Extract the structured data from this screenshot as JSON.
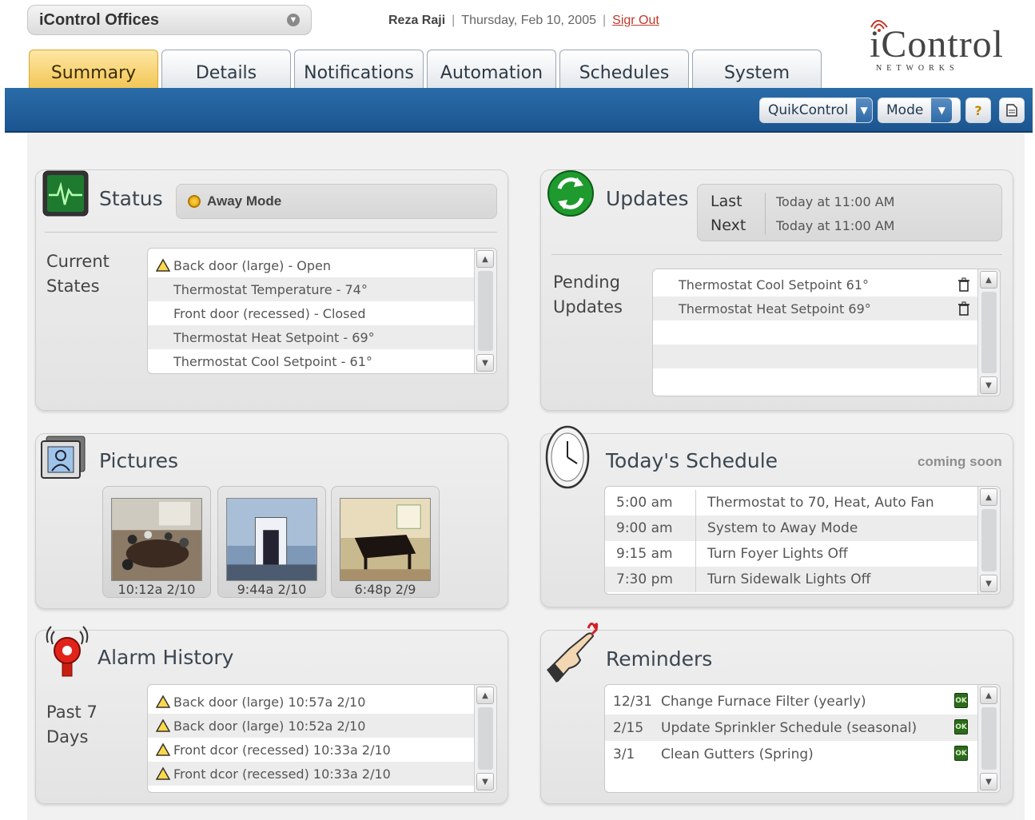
{
  "header": {
    "site_selector": "iControl Offices",
    "user": "Reza Raji",
    "separator": "|",
    "date": "Thursday, Feb 10, 2005",
    "sign_out": "Sigr Out",
    "logo_text": "iControl",
    "logo_sub": "NETWORKS"
  },
  "tabs": [
    {
      "label": "Summary",
      "active": true
    },
    {
      "label": "Details"
    },
    {
      "label": "Notifications"
    },
    {
      "label": "Automation"
    },
    {
      "label": "Schedules"
    },
    {
      "label": "System"
    }
  ],
  "toolbar": {
    "quikcontrol": "QuikControl",
    "mode": "Mode",
    "help_glyph": "?"
  },
  "status": {
    "title": "Status",
    "mode": "Away Mode",
    "label_line1": "Current",
    "label_line2": "States",
    "items": [
      {
        "text": "Back door (large) - Open",
        "warn": true
      },
      {
        "text": "Thermostat Temperature - 74°"
      },
      {
        "text": "Front door (recessed) - Closed"
      },
      {
        "text": "Thermostat Heat Setpoint - 69°"
      },
      {
        "text": "Thermostat Cool Setpoint - 61°"
      }
    ]
  },
  "updates": {
    "title": "Updates",
    "last_label": "Last",
    "last_value": "Today at 11:00 AM",
    "next_label": "Next",
    "next_value": "Today at 11:00 AM",
    "pending_line1": "Pending",
    "pending_line2": "Updates",
    "pending": [
      "Thermostat Cool Setpoint 61°",
      "Thermostat Heat Setpoint 69°"
    ]
  },
  "pictures": {
    "title": "Pictures",
    "items": [
      "10:12a 2/10",
      "9:44a 2/10",
      "6:48p 2/9"
    ]
  },
  "schedule": {
    "title": "Today's Schedule",
    "badge": "coming soon",
    "items": [
      {
        "time": "5:00 am",
        "desc": "Thermostat to 70, Heat, Auto Fan"
      },
      {
        "time": "9:00 am",
        "desc": "System to Away Mode"
      },
      {
        "time": "9:15 am",
        "desc": "Turn Foyer Lights Off"
      },
      {
        "time": "7:30 pm",
        "desc": "Turn Sidewalk Lights Off"
      }
    ]
  },
  "alarm": {
    "title": "Alarm History",
    "label_line1": "Past 7",
    "label_line2": "Days",
    "items": [
      "Back door (large) 10:57a 2/10",
      "Back door (large) 10:52a 2/10",
      "Front dcor (recessed) 10:33a 2/10",
      "Front dcor (recessed) 10:33a 2/10"
    ]
  },
  "reminders": {
    "title": "Reminders",
    "ok_label": "OK",
    "items": [
      {
        "date": "12/31",
        "text": "Change Furnace Filter (yearly)"
      },
      {
        "date": "2/15",
        "text": "Update Sprinkler Schedule (seasonal)"
      },
      {
        "date": "3/1",
        "text": "Clean Gutters (Spring)"
      }
    ]
  },
  "colors": {
    "accent_blue": "#1b5590",
    "active_tab": "#f3c552",
    "panel_bg": "#e8e8e8",
    "warning": "#e0a100"
  }
}
